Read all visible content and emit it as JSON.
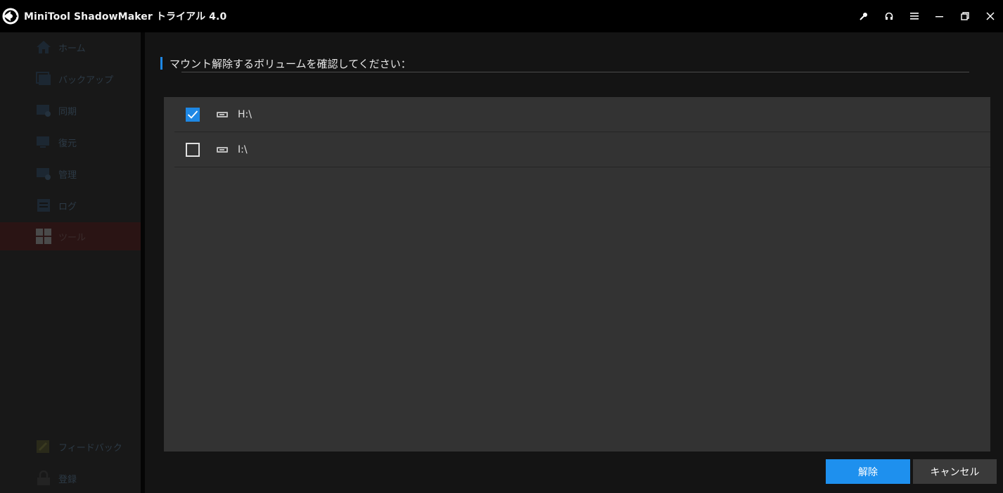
{
  "window": {
    "title": "MiniTool ShadowMaker トライアル 4.0"
  },
  "titlebar_icons": [
    "key-icon",
    "headset-icon",
    "menu-icon",
    "minimize-icon",
    "restore-icon",
    "close-icon"
  ],
  "sidebar": {
    "items": [
      {
        "label": "ホーム",
        "icon": "home-icon"
      },
      {
        "label": "バックアップ",
        "icon": "backup-icon"
      },
      {
        "label": "同期",
        "icon": "sync-icon"
      },
      {
        "label": "復元",
        "icon": "restore-icon"
      },
      {
        "label": "管理",
        "icon": "manage-icon"
      },
      {
        "label": "ログ",
        "icon": "log-icon"
      },
      {
        "label": "ツール",
        "icon": "tools-icon",
        "active": true
      }
    ],
    "bottom_items": [
      {
        "label": "フィードバック",
        "icon": "feedback-icon"
      },
      {
        "label": "登録",
        "icon": "lock-icon"
      }
    ]
  },
  "main": {
    "heading": "マウント解除するボリュームを確認してください：",
    "volumes": [
      {
        "label": "H:\\",
        "checked": true
      },
      {
        "label": "I:\\",
        "checked": false
      }
    ],
    "buttons": {
      "unmount": "解除",
      "cancel": "キャンセル"
    }
  },
  "colors": {
    "accent": "#1e88e5",
    "panel": "#333333",
    "background": "#141414"
  }
}
